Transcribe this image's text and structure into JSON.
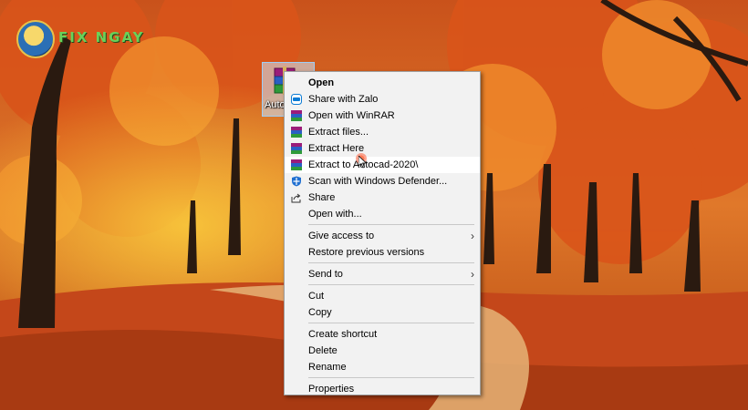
{
  "logo": {
    "text": "FIX NGAY"
  },
  "desktop_file": {
    "label": "Auto"
  },
  "menu": {
    "items": [
      {
        "label": "Open",
        "icon": "none",
        "bold": true
      },
      {
        "label": "Share with Zalo",
        "icon": "zalo-icon"
      },
      {
        "label": "Open with WinRAR",
        "icon": "winrar-icon"
      },
      {
        "label": "Extract files...",
        "icon": "winrar-icon"
      },
      {
        "label": "Extract Here",
        "icon": "winrar-icon"
      },
      {
        "label": "Extract to Autocad-2020\\",
        "icon": "winrar-icon",
        "hovered": true
      },
      {
        "label": "Scan with Windows Defender...",
        "icon": "defender-shield-icon"
      },
      {
        "label": "Share",
        "icon": "share-icon"
      },
      {
        "label": "Open with...",
        "icon": "none"
      },
      {
        "label": "Give access to",
        "icon": "none",
        "submenu": true
      },
      {
        "label": "Restore previous versions",
        "icon": "none"
      },
      {
        "label": "Send to",
        "icon": "none",
        "submenu": true
      },
      {
        "label": "Cut",
        "icon": "none"
      },
      {
        "label": "Copy",
        "icon": "none"
      },
      {
        "label": "Create shortcut",
        "icon": "none"
      },
      {
        "label": "Delete",
        "icon": "none"
      },
      {
        "label": "Rename",
        "icon": "none"
      },
      {
        "label": "Properties",
        "icon": "none"
      }
    ],
    "submenu_arrow": "›"
  },
  "colors": {
    "menu_bg": "#f2f2f2",
    "hover_bg": "#ffffff",
    "selection": "#cce8ff",
    "logo_green": "#6ad15a"
  }
}
